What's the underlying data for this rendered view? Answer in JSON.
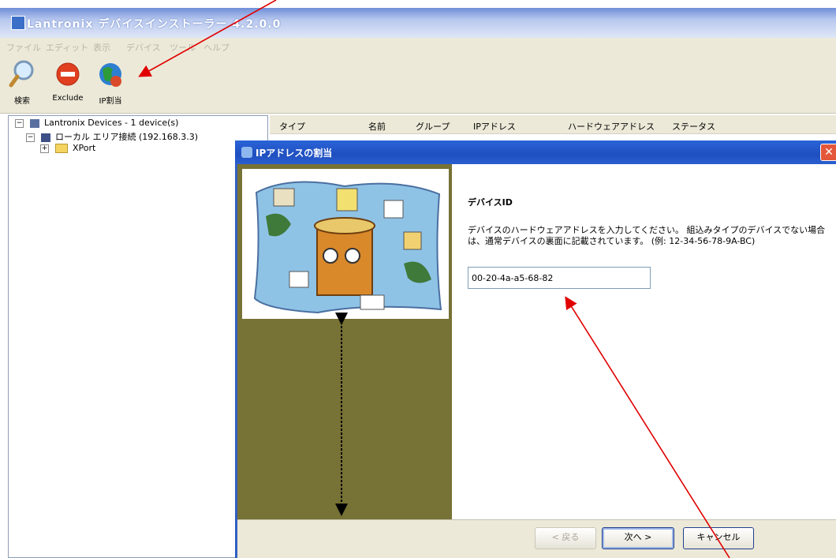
{
  "window": {
    "title": "Lantronix デバイスインストーラー 4.2.0.0",
    "menu": [
      "ファイル",
      "エディット",
      "表示",
      "デバイス",
      "ツール",
      "ヘルプ"
    ]
  },
  "toolbar": {
    "search_label": "検索",
    "exclude_label": "Exclude",
    "ip_assign_label": "IP割当"
  },
  "tree": {
    "root": "Lantronix Devices - 1 device(s)",
    "network": "ローカル エリア接続 (192.168.3.3)",
    "folder": "XPort"
  },
  "list": {
    "columns": [
      "タイプ",
      "名前",
      "グループ",
      "IPアドレス",
      "ハードウェアアドレス",
      "ステータス"
    ]
  },
  "dialog": {
    "title": "IPアドレスの割当",
    "heading": "デバイスID",
    "description": "デバイスのハードウェアアドレスを入力してください。 組込みタイプのデバイスでない場合は、通常デバイスの裏面に記載されています。 (例: 12-34-56-78-9A-BC)",
    "hw_address_value": "00-20-4a-a5-68-82",
    "back_label": "< 戻る",
    "next_label": "次へ >",
    "cancel_label": "キャンセル",
    "close_symbol": "✕"
  },
  "colors": {
    "annotation_arrow": "#e00000",
    "dialog_titlebar": "#2a64d8",
    "left_panel": "#777235"
  }
}
